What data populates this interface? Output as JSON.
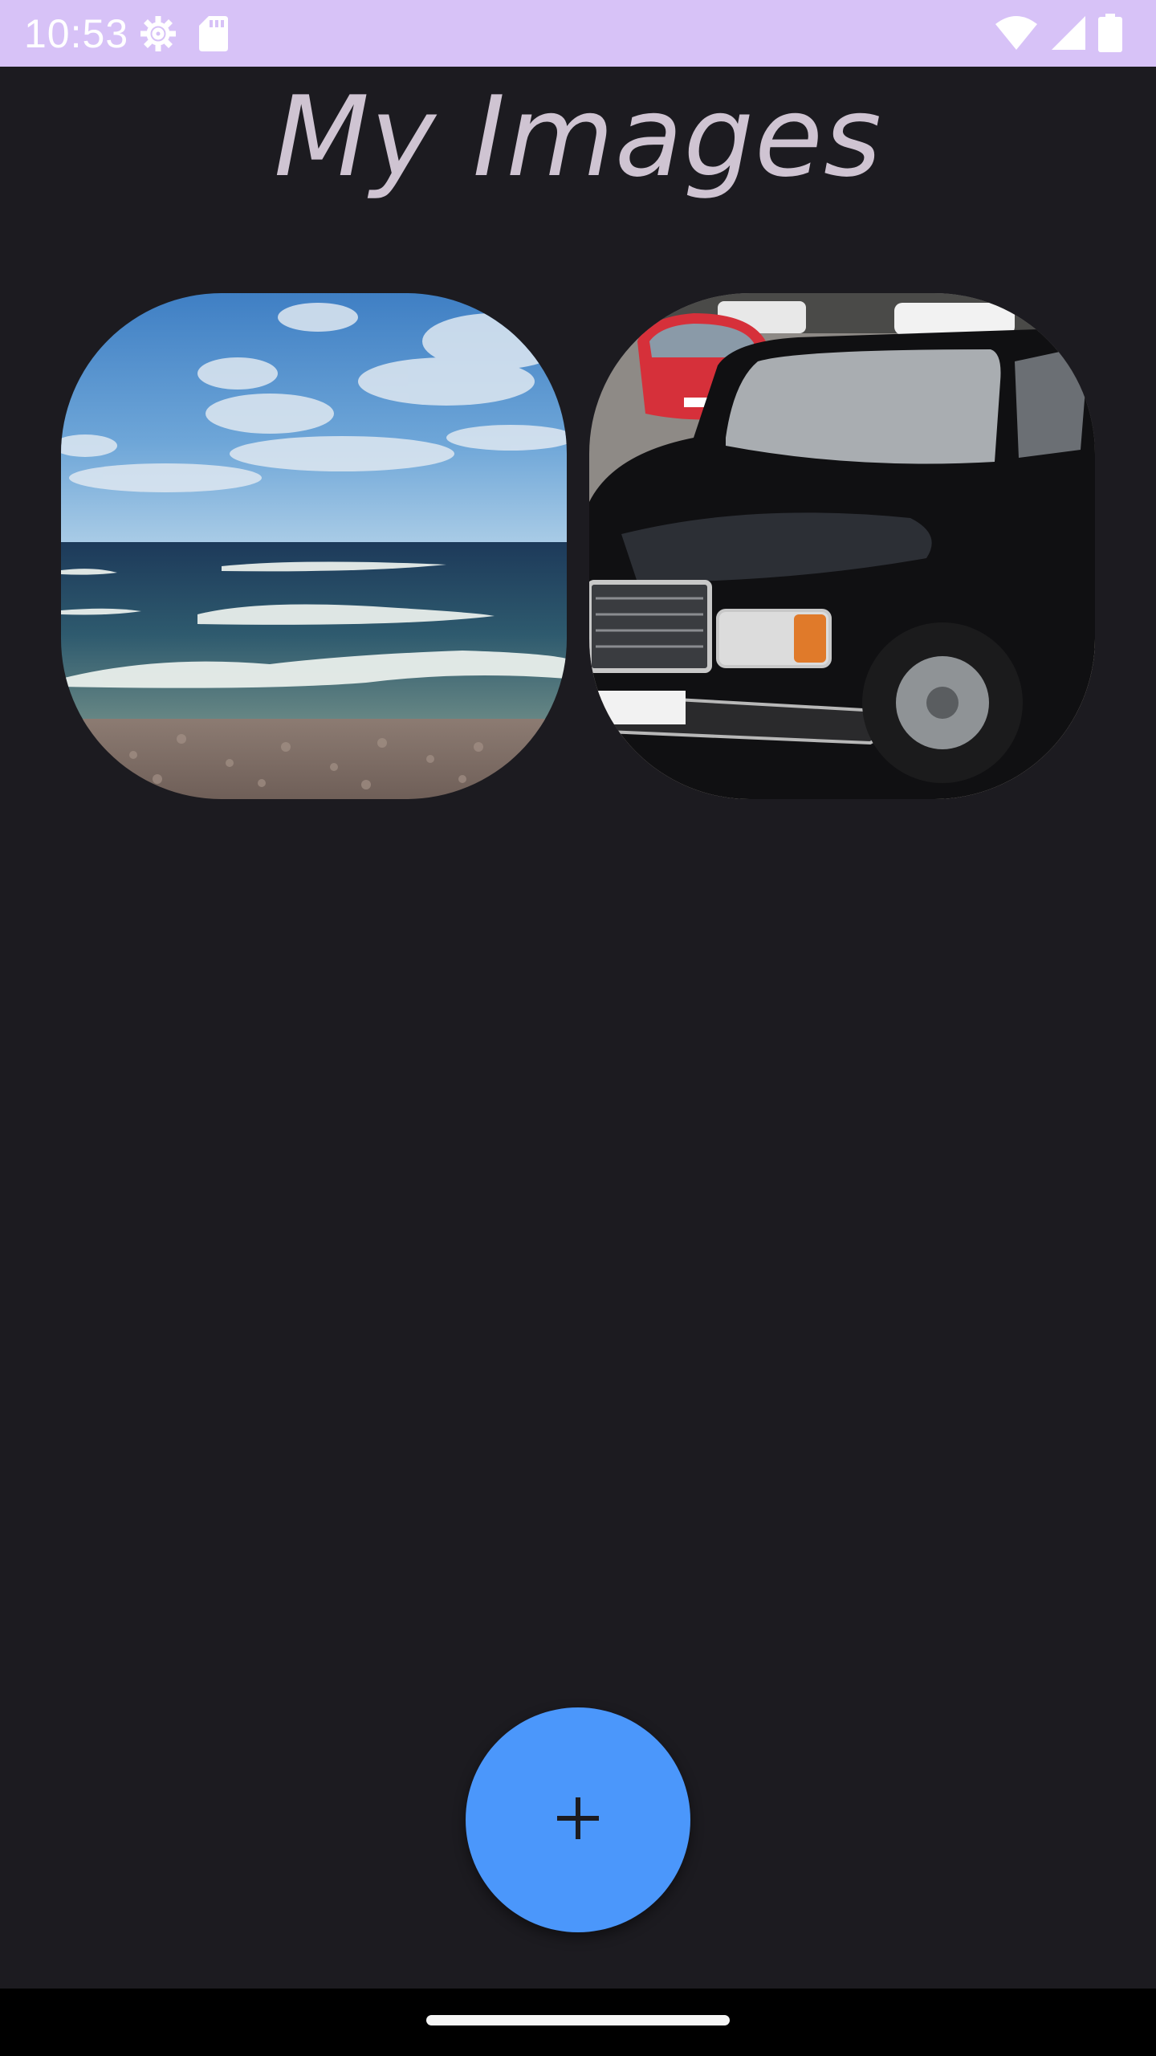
{
  "status_bar": {
    "time": "10:53",
    "icons_left": [
      "settings-icon",
      "sd-card-icon"
    ],
    "icons_right": [
      "wifi-icon",
      "signal-icon",
      "battery-icon"
    ],
    "background_color": "#d7c2f7"
  },
  "app": {
    "title": "My Images"
  },
  "images": [
    {
      "name": "sea-waves-image"
    },
    {
      "name": "black-car-image"
    }
  ],
  "fab": {
    "icon": "plus-icon",
    "color": "#4b97fb"
  },
  "nav_bar": {
    "handle": "home-gesture-handle"
  }
}
